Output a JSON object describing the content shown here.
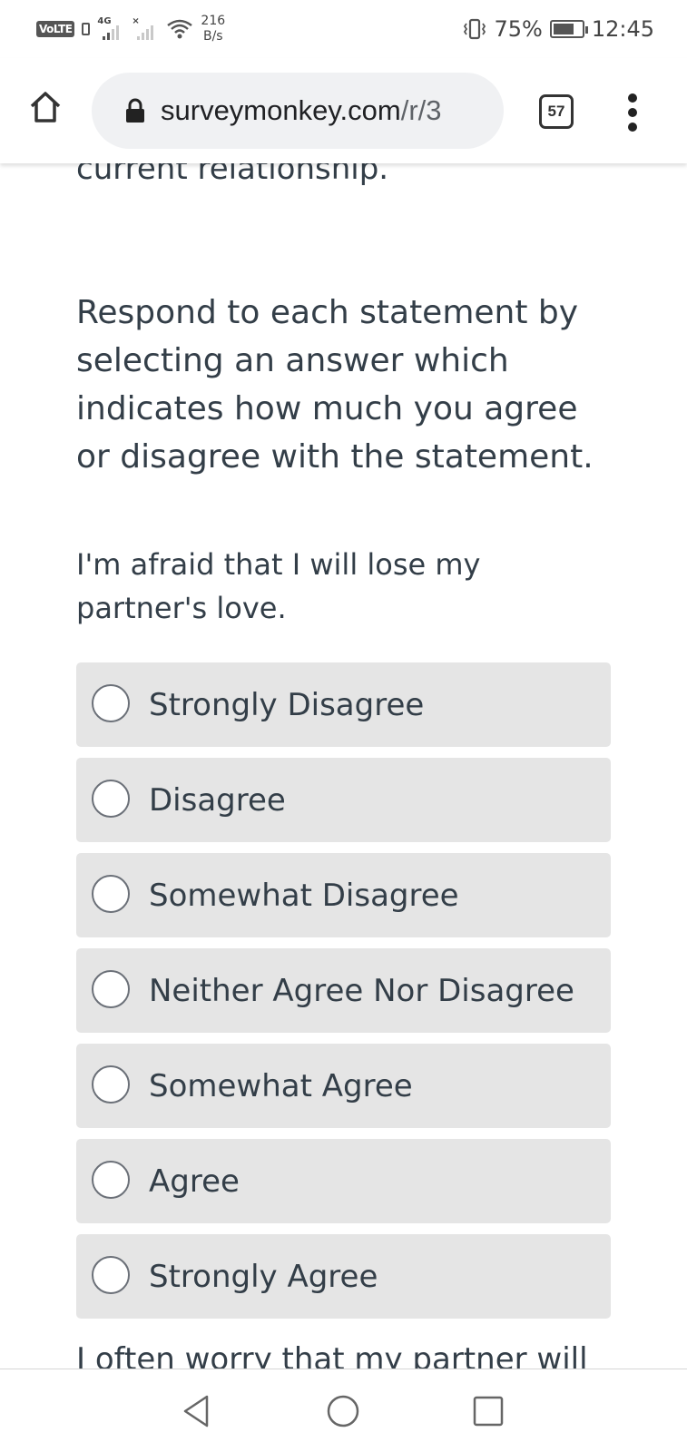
{
  "status_bar": {
    "volte": "VoLTE",
    "network_tag": "4G",
    "speed_value": "216",
    "speed_unit": "B/s",
    "battery": "75%",
    "time": "12:45"
  },
  "browser": {
    "url_host": "surveymonkey.com",
    "url_path": "/r/3",
    "tab_count": "57"
  },
  "survey": {
    "intro_tail": "current relationship.",
    "instructions": "Respond to each statement by selecting an answer which indicates how much you agree or disagree with the statement.",
    "question": "I'm afraid that I will lose my partner's love.",
    "options": [
      "Strongly Disagree",
      "Disagree",
      "Somewhat Disagree",
      "Neither Agree Nor Disagree",
      "Somewhat Agree",
      "Agree",
      "Strongly Agree"
    ],
    "next_question_partial": "I often worry that my partner will"
  },
  "colors": {
    "option_bg": "#e5e5e5",
    "text": "#333e48",
    "url_pill": "#f0f1f3"
  }
}
